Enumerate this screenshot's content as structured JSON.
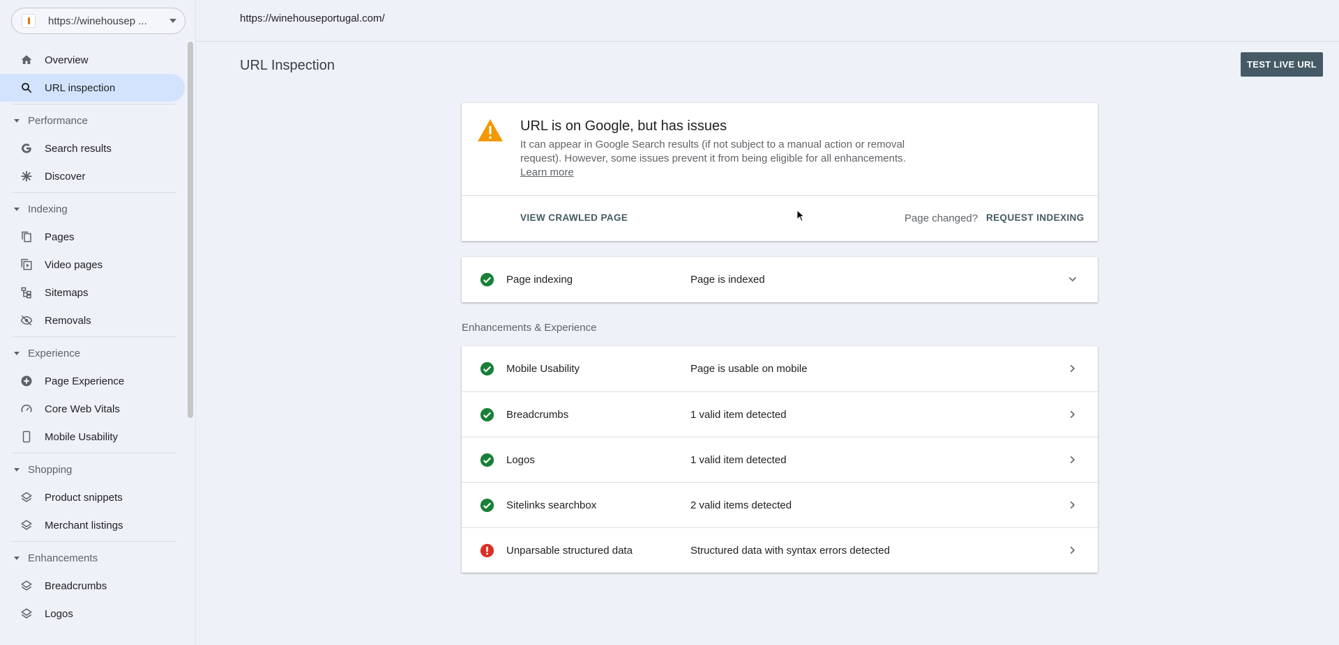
{
  "property": {
    "label": "https://winehousep ..."
  },
  "sidebar": {
    "top_items": [
      {
        "label": "Overview",
        "icon": "home-icon"
      },
      {
        "label": "URL inspection",
        "icon": "search-icon",
        "active": true
      }
    ],
    "sections": [
      {
        "title": "Performance",
        "items": [
          {
            "label": "Search results",
            "icon": "google-g-icon"
          },
          {
            "label": "Discover",
            "icon": "asterisk-icon"
          }
        ]
      },
      {
        "title": "Indexing",
        "items": [
          {
            "label": "Pages",
            "icon": "pages-icon"
          },
          {
            "label": "Video pages",
            "icon": "video-pages-icon"
          },
          {
            "label": "Sitemaps",
            "icon": "sitemap-icon"
          },
          {
            "label": "Removals",
            "icon": "eye-off-icon"
          }
        ]
      },
      {
        "title": "Experience",
        "items": [
          {
            "label": "Page Experience",
            "icon": "plus-circle-icon"
          },
          {
            "label": "Core Web Vitals",
            "icon": "gauge-icon"
          },
          {
            "label": "Mobile Usability",
            "icon": "phone-icon"
          }
        ]
      },
      {
        "title": "Shopping",
        "items": [
          {
            "label": "Product snippets",
            "icon": "layers-icon"
          },
          {
            "label": "Merchant listings",
            "icon": "layers-icon"
          }
        ]
      },
      {
        "title": "Enhancements",
        "items": [
          {
            "label": "Breadcrumbs",
            "icon": "layers-icon"
          },
          {
            "label": "Logos",
            "icon": "layers-icon"
          }
        ]
      }
    ]
  },
  "topbar": {
    "url": "https://winehouseportugal.com/"
  },
  "page": {
    "title": "URL Inspection",
    "test_live_label": "TEST LIVE URL"
  },
  "status": {
    "title": "URL is on Google, but has issues",
    "description": "It can appear in Google Search results (if not subject to a manual action or removal request). However, some issues prevent it from being eligible for all enhancements.",
    "learn_more": "Learn more",
    "view_crawled": "VIEW CRAWLED PAGE",
    "page_changed": "Page changed?",
    "request_indexing": "REQUEST INDEXING",
    "warning_color": "#f29900"
  },
  "indexing": {
    "label": "Page indexing",
    "value": "Page is indexed",
    "state": "valid"
  },
  "enhancements": {
    "heading": "Enhancements & Experience",
    "rows": [
      {
        "label": "Mobile Usability",
        "value": "Page is usable on mobile",
        "state": "valid"
      },
      {
        "label": "Breadcrumbs",
        "value": "1 valid item detected",
        "state": "valid"
      },
      {
        "label": "Logos",
        "value": "1 valid item detected",
        "state": "valid"
      },
      {
        "label": "Sitelinks searchbox",
        "value": "2 valid items detected",
        "state": "valid"
      },
      {
        "label": "Unparsable structured data",
        "value": "Structured data with syntax errors detected",
        "state": "error"
      }
    ]
  },
  "colors": {
    "valid": "#188038",
    "error": "#d93025",
    "active_nav": "#d3e3fd",
    "button": "#455a64"
  }
}
